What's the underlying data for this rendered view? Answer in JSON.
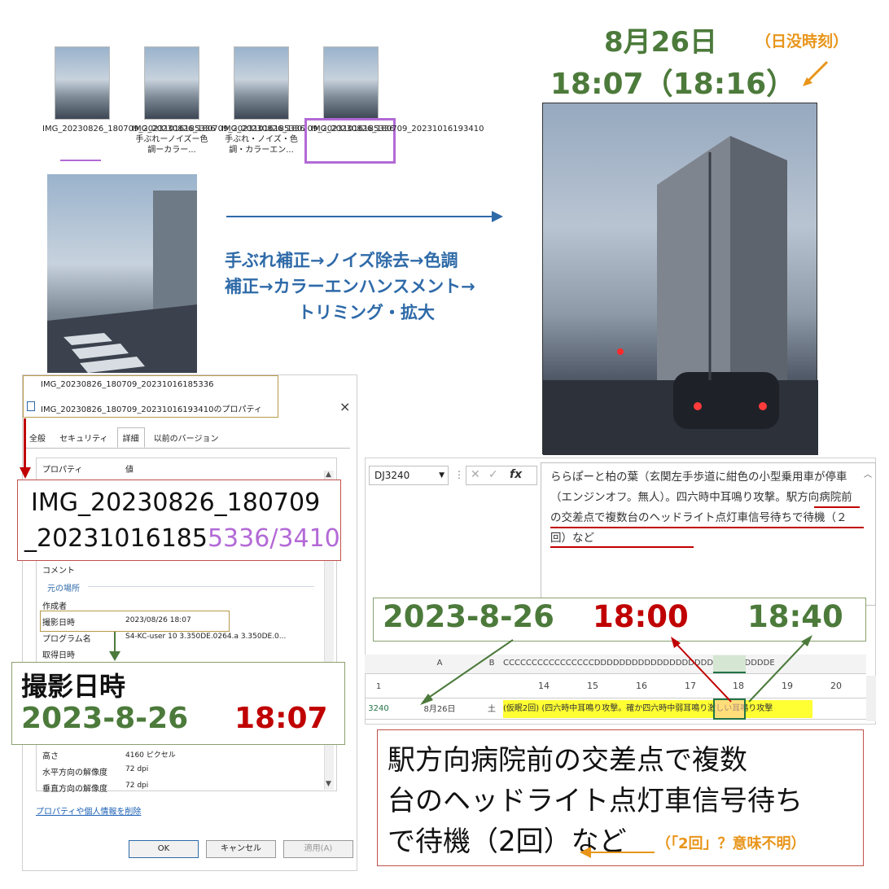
{
  "header": {
    "date": "8月26日",
    "sunset_label": "（日没時刻）",
    "time": "18:07（18:16）"
  },
  "thumbnails": [
    {
      "caption": "IMG_20230826_180709_20231016185336"
    },
    {
      "caption": "IMG_20230826_180709_20231016185336手ぶれーノイズー色調ーカラー..."
    },
    {
      "caption": "IMG_20230826_180709_20231016185336手ぶれ・ノイズ・色調・カラーエン..."
    },
    {
      "caption": "IMG_20230826_180709_20231016193410"
    }
  ],
  "process": {
    "line1": "手ぶれ補正→ノイズ除去→色調",
    "line2": "補正→カラーエンハンスメント→",
    "line3": "トリミング・拡大"
  },
  "properties_window": {
    "prev_file": "IMG_20230826_180709_20231016185336",
    "title": "IMG_20230826_180709_20231016193410のプロパティ",
    "close": "×",
    "tabs": [
      "全般",
      "セキュリティ",
      "詳細",
      "以前のバージョン"
    ],
    "col_property": "プロパティ",
    "col_value": "値",
    "rows": [
      {
        "label": "コメント",
        "value": ""
      },
      {
        "label": "元の場所",
        "value": ""
      },
      {
        "label": "作成者",
        "value": ""
      },
      {
        "label": "撮影日時",
        "value": "2023/08/26 18:07"
      },
      {
        "label": "プログラム名",
        "value": "S4-KC-user 10 3.350DE.0264.a 3.350DE.0..."
      },
      {
        "label": "取得日時",
        "value": ""
      },
      {
        "label": "高さ",
        "value": "4160 ピクセル"
      },
      {
        "label": "水平方向の解像度",
        "value": "72 dpi"
      },
      {
        "label": "垂直方向の解像度",
        "value": "72 dpi"
      }
    ],
    "remove_link": "プロパティや個人情報を削除",
    "ok": "OK",
    "cancel": "キャンセル",
    "apply": "適用(A)"
  },
  "filename_callout": {
    "line1": "IMG_20230826_180709",
    "line2_prefix": "_20231016185",
    "line2_suffix": "5336/3410"
  },
  "date_callout": {
    "label": "撮影日時",
    "date": "2023-8-26",
    "time": "18:07"
  },
  "excel": {
    "namebox": "DJ3240",
    "fx": "fx",
    "formula_text": "ららぽーと柏の葉（玄関左手歩道に紺色の小型乗用車が停車（エンジンオフ。無人）。四六時中耳鳴り攻撃。駅方向病院前の交差点で複数台のヘッドライト点灯車信号待ちで待機（２回）など",
    "col_a": "A",
    "col_b": "B",
    "col_letters": "CCCCCCCCCCCCCCCCDDDDDDDDDDDDDDDDDDDDDDDDDDDDE",
    "hours": [
      "14",
      "15",
      "16",
      "17",
      "18",
      "19",
      "20"
    ],
    "row_header": "1",
    "row_num": "3240",
    "row_date": "8月26日",
    "row_day": "土",
    "row_text": "(仮眠2回) (四六時中耳鳴り攻撃。確か四六時中弱耳鳴り激しい耳鳴り攻撃"
  },
  "time_callout": {
    "date": "2023-8-26",
    "start": "18:00",
    "end": "18:40"
  },
  "note_callout": {
    "line1": "駅方向病院前の交差点で複数",
    "line2": "台のヘッドライト点灯車信号待ち",
    "line3": "で待機（2回）など",
    "remark": "（「2回」？意味不明）"
  },
  "colors": {
    "green": "#4c7a3b",
    "red": "#c00000",
    "purple": "#b36ad6",
    "orange": "#e8951a",
    "blue": "#2e6aa8"
  }
}
